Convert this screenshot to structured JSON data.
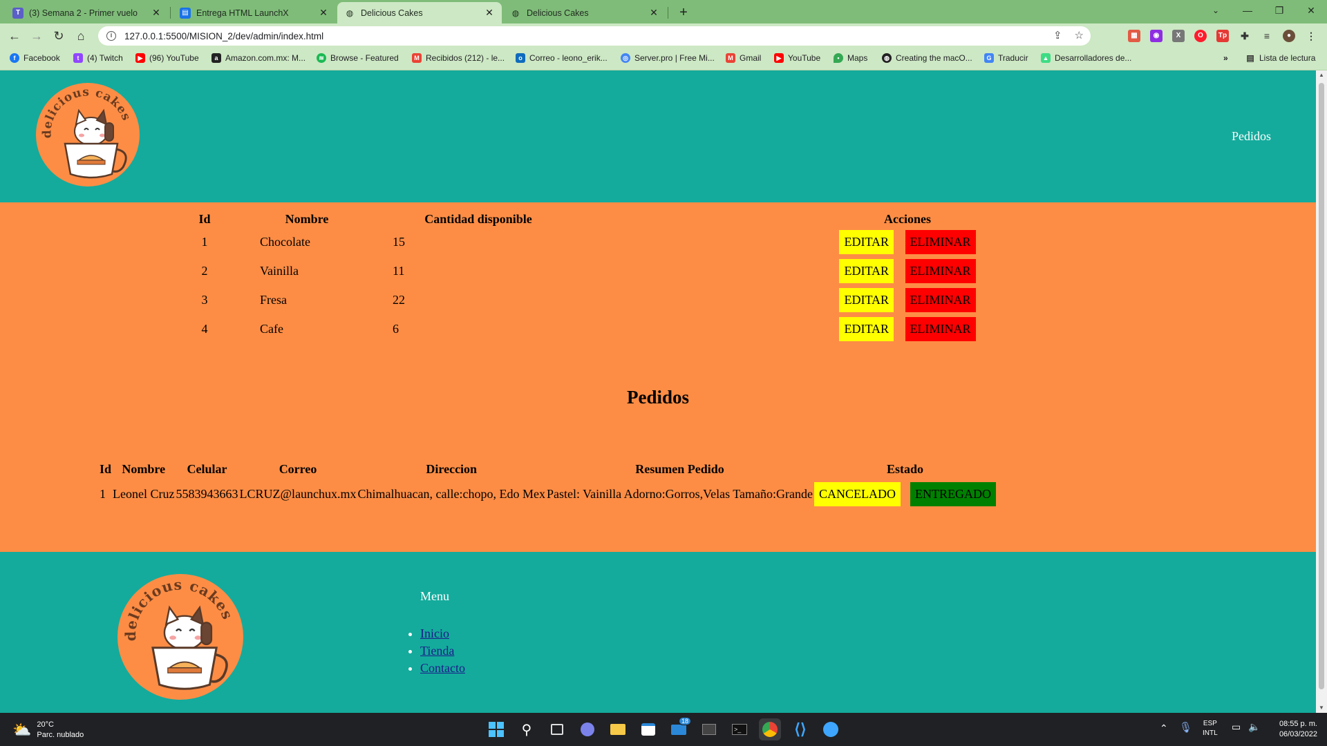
{
  "browser": {
    "tabs": [
      {
        "title": "(3) Semana 2 - Primer vuelo",
        "icon": "teams-icon",
        "active": false
      },
      {
        "title": "Entrega HTML LaunchX",
        "icon": "sites-icon",
        "active": false
      },
      {
        "title": "Delicious Cakes",
        "icon": "globe-icon",
        "active": true
      },
      {
        "title": "Delicious Cakes",
        "icon": "globe-icon",
        "active": false
      }
    ],
    "url": "127.0.0.1:5500/MISION_2/dev/admin/index.html",
    "bookmarks": [
      {
        "label": "Facebook",
        "color": "#1877f2"
      },
      {
        "label": "(4) Twitch",
        "color": "#9146ff"
      },
      {
        "label": "(96) YouTube",
        "color": "#ff0000"
      },
      {
        "label": "Amazon.com.mx: M...",
        "color": "#222222"
      },
      {
        "label": "Browse - Featured",
        "color": "#1db954"
      },
      {
        "label": "Recibidos (212) - le...",
        "color": "#ea4335"
      },
      {
        "label": "Correo - leono_erik...",
        "color": "#0f6cbd"
      },
      {
        "label": "Server.pro | Free Mi...",
        "color": "#4285f4"
      },
      {
        "label": "Gmail",
        "color": "#ea4335"
      },
      {
        "label": "YouTube",
        "color": "#ff0000"
      },
      {
        "label": "Maps",
        "color": "#34a853"
      },
      {
        "label": "Creating the macO...",
        "color": "#222222"
      },
      {
        "label": "Traducir",
        "color": "#4285f4"
      },
      {
        "label": "Desarrolladores de...",
        "color": "#3ddc84"
      }
    ],
    "reading_list": "Lista de lectura"
  },
  "page": {
    "header": {
      "logo_text": "delicious cakes",
      "nav_link": "Pedidos"
    },
    "inventory": {
      "headers": [
        "Id",
        "Nombre",
        "Cantidad disponible",
        "Acciones"
      ],
      "rows": [
        {
          "id": "1",
          "nombre": "Chocolate",
          "cantidad": "15"
        },
        {
          "id": "2",
          "nombre": "Vainilla",
          "cantidad": "11"
        },
        {
          "id": "3",
          "nombre": "Fresa",
          "cantidad": "22"
        },
        {
          "id": "4",
          "nombre": "Cafe",
          "cantidad": "6"
        }
      ],
      "edit_label": "EDITAR",
      "delete_label": "ELIMINAR"
    },
    "orders": {
      "title": "Pedidos",
      "headers": [
        "Id",
        "Nombre",
        "Celular",
        "Correo",
        "Direccion",
        "Resumen Pedido",
        "Estado"
      ],
      "rows": [
        {
          "id": "1",
          "nombre": "Leonel Cruz",
          "celular": "5583943663",
          "correo": "LCRUZ@launchux.mx",
          "direccion": "Chimalhuacan, calle:chopo, Edo Mex",
          "resumen": "Pastel: Vainilla Adorno:Gorros,Velas Tamaño:Grande"
        }
      ],
      "cancel_label": "CANCELADO",
      "delivered_label": "ENTREGADO"
    },
    "footer": {
      "menu_title": "Menu",
      "links": [
        "Inicio",
        "Tienda",
        "Contacto"
      ]
    }
  },
  "taskbar": {
    "weather_temp": "20°C",
    "weather_desc": "Parc. nublado",
    "lang_top": "ESP",
    "lang_bottom": "INTL",
    "time": "08:55 p. m.",
    "date": "06/03/2022",
    "mail_badge": "18"
  },
  "colors": {
    "teal": "#14ab9c",
    "orange": "#fd8d45",
    "edit": "#ffff00",
    "delete": "#ff0000",
    "delivered": "#008000"
  }
}
